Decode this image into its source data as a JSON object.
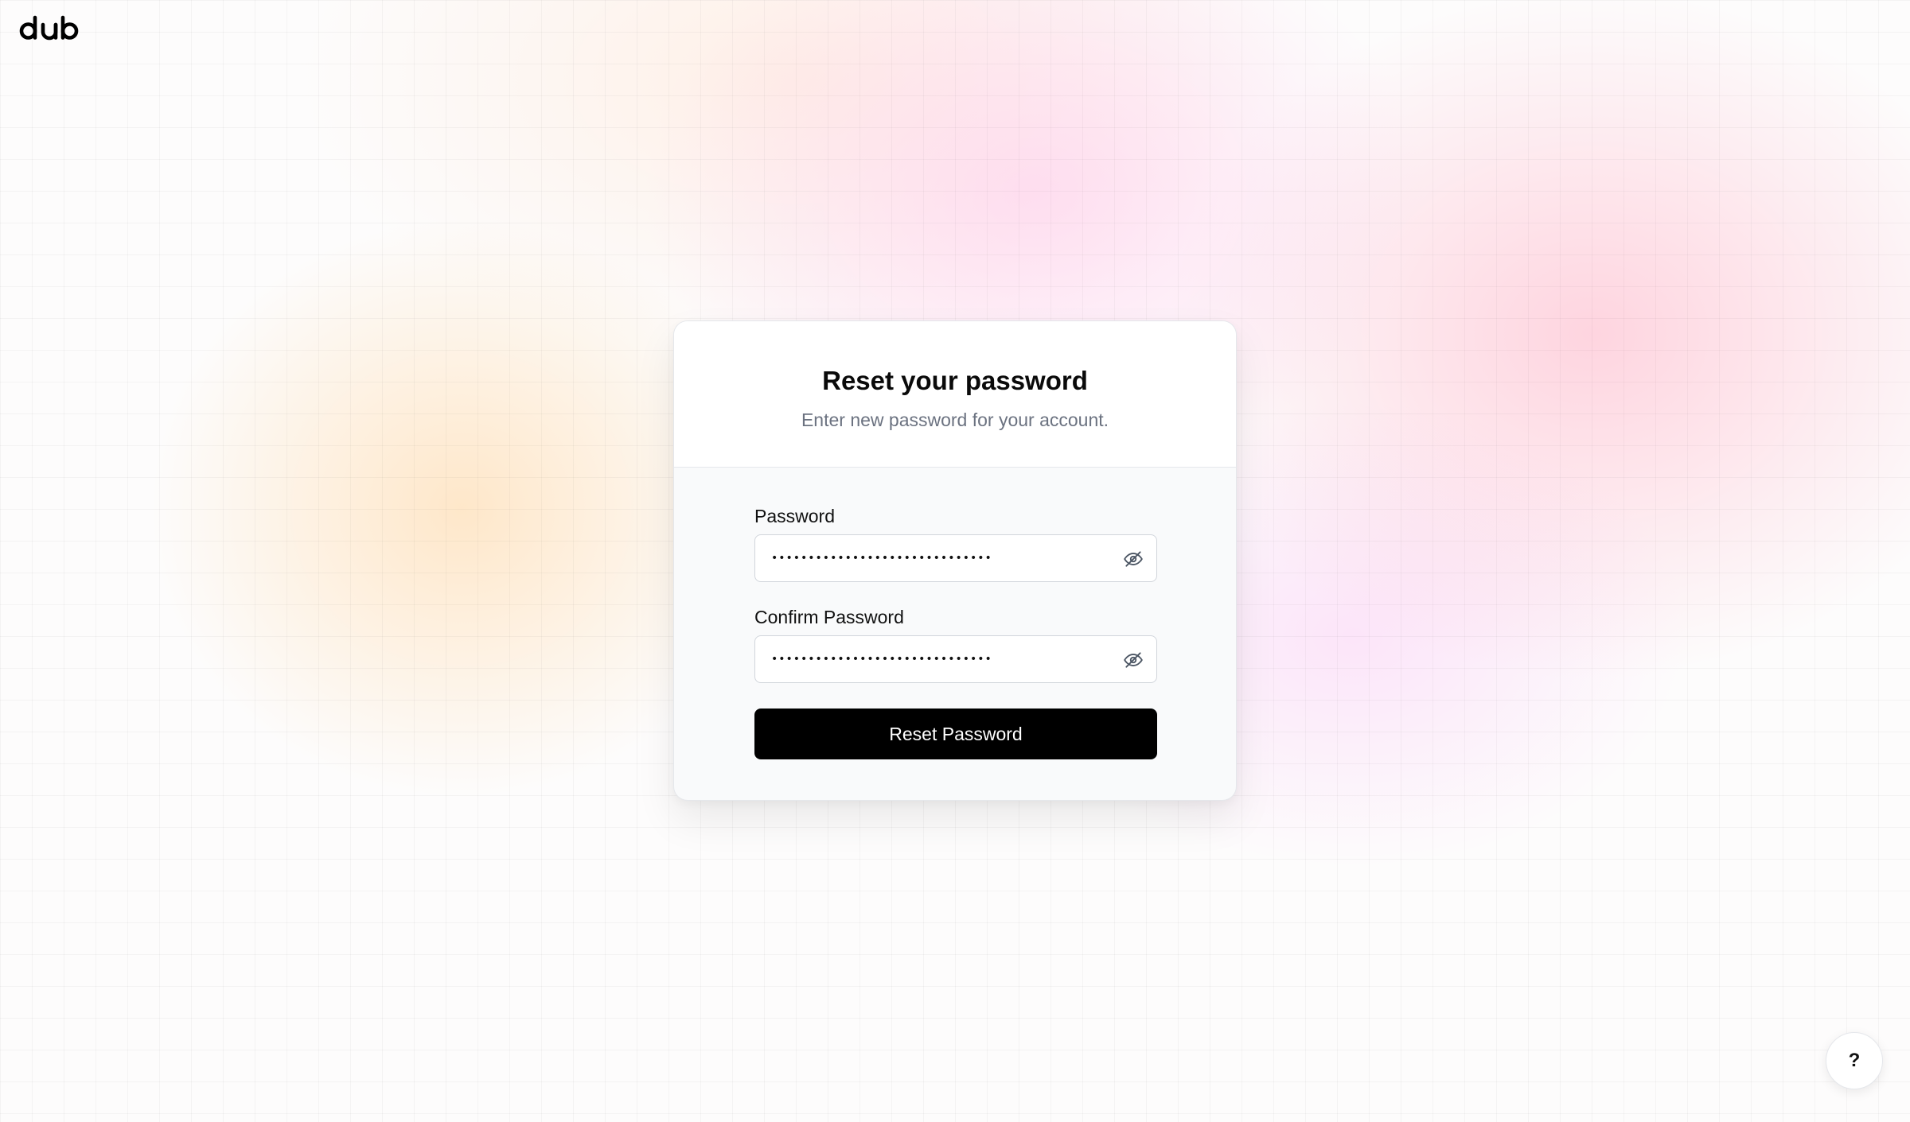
{
  "app": {
    "logo_text": "dub"
  },
  "card": {
    "title": "Reset your password",
    "subtitle": "Enter new password for your account."
  },
  "form": {
    "password": {
      "label": "Password",
      "value": "••••••••••••••••••••••••••••••",
      "toggle_icon": "eye-off-icon"
    },
    "confirm_password": {
      "label": "Confirm Password",
      "value": "••••••••••••••••••••••••••••••",
      "toggle_icon": "eye-off-icon"
    },
    "submit_label": "Reset Password"
  },
  "help_button": {
    "label": "?"
  },
  "colors": {
    "primary_button": "#000000",
    "card_header_bg": "#ffffff",
    "card_body_bg": "#f9fafb",
    "muted_text": "#6b7280"
  }
}
